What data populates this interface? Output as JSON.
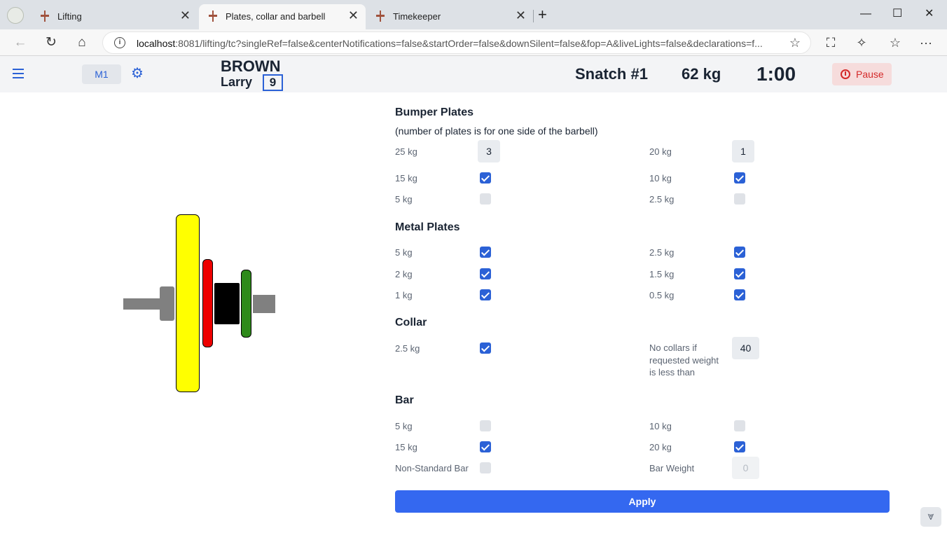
{
  "browser": {
    "tabs": [
      {
        "label": "Lifting",
        "active": false
      },
      {
        "label": "Plates, collar and barbell",
        "active": true
      },
      {
        "label": "Timekeeper",
        "active": false
      }
    ],
    "close_glyph": "✕",
    "new_tab_glyph": "+",
    "window": {
      "minimize": "—",
      "maximize": "☐",
      "close": "✕"
    },
    "url_host": "localhost",
    "url_rest": ":8081/lifting/tc?singleRef=false&centerNotifications=false&startOrder=false&downSilent=false&fop=A&liveLights=false&declarations=f...",
    "nav": {
      "back": "←",
      "reload": "↻",
      "home": "⌂"
    },
    "icons": {
      "info": "i",
      "star": "☆",
      "screenshot": "⛶",
      "extensions": "✧",
      "favorites": "☆",
      "menu": "···"
    }
  },
  "header": {
    "platform": "M1",
    "lastname": "BROWN",
    "firstname": "Larry",
    "start_number": "9",
    "attempt": "Snatch #1",
    "weight": "62 kg",
    "clock": "1:00",
    "pause_label": "Pause",
    "gear_glyph": "⚙",
    "colors": {
      "accent": "#2b61d6",
      "pause_bg": "#f6dcdc",
      "pause_fg": "#d42a2a"
    }
  },
  "barbell": {
    "plates_one_side": [
      {
        "name": "bumper-25",
        "color": "#ffff00"
      },
      {
        "name": "bumper-15",
        "color": "#ee0000"
      },
      {
        "name": "metal-5",
        "color": "#000000"
      },
      {
        "name": "metal-2.5",
        "color": "#2e8a1a"
      }
    ],
    "bar_color": "#808080"
  },
  "bumper": {
    "title": "Bumper Plates",
    "subtitle": "(number of plates is for one side of the barbell)",
    "p25": {
      "label": "25 kg",
      "value": "3"
    },
    "p20": {
      "label": "20 kg",
      "value": "1"
    },
    "p15": {
      "label": "15 kg",
      "checked": true
    },
    "p10": {
      "label": "10 kg",
      "checked": true
    },
    "p5": {
      "label": "5 kg",
      "checked": false
    },
    "p2_5": {
      "label": "2.5 kg",
      "checked": false
    }
  },
  "metal": {
    "title": "Metal Plates",
    "p5": {
      "label": "5 kg",
      "checked": true
    },
    "p2_5": {
      "label": "2.5 kg",
      "checked": true
    },
    "p2": {
      "label": "2 kg",
      "checked": true
    },
    "p1_5": {
      "label": "1.5 kg",
      "checked": true
    },
    "p1": {
      "label": "1 kg",
      "checked": true
    },
    "p0_5": {
      "label": "0.5 kg",
      "checked": true
    }
  },
  "collar": {
    "title": "Collar",
    "c2_5": {
      "label": "2.5 kg",
      "checked": true
    },
    "threshold_label": "No collars if requested weight is less than",
    "threshold_value": "40"
  },
  "bar": {
    "title": "Bar",
    "b5": {
      "label": "5 kg",
      "checked": false
    },
    "b10": {
      "label": "10 kg",
      "checked": false
    },
    "b15": {
      "label": "15 kg",
      "checked": true
    },
    "b20": {
      "label": "20 kg",
      "checked": true
    },
    "nonstandard": {
      "label": "Non-Standard Bar",
      "checked": false
    },
    "bar_weight": {
      "label": "Bar Weight",
      "value": "0"
    }
  },
  "apply_label": "Apply",
  "corner_glyph": "⩔"
}
